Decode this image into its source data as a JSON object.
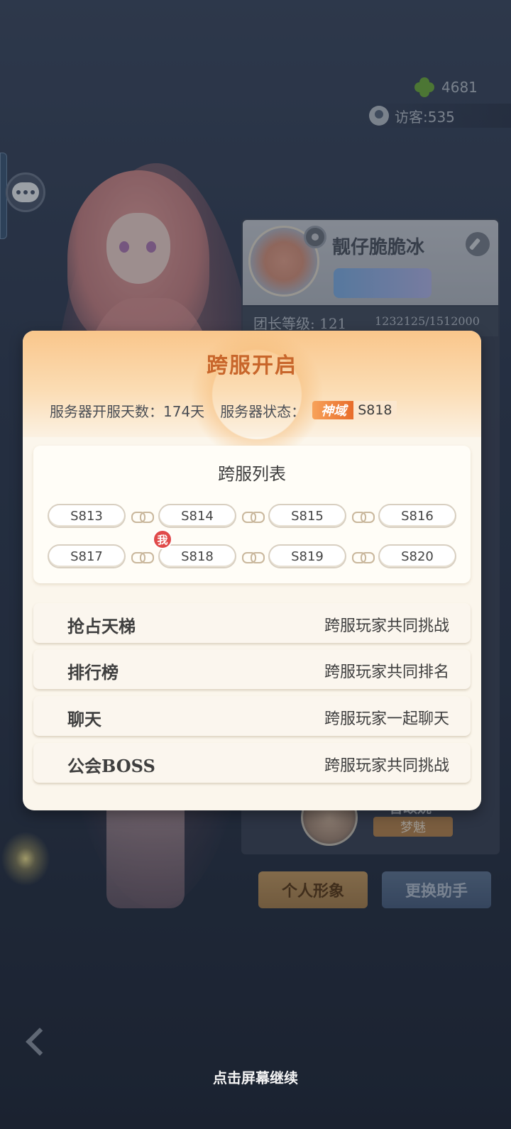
{
  "hud": {
    "clover_count": "4681",
    "visitors": "访客:535"
  },
  "profile": {
    "name": "靓仔脆脆冰",
    "level_label": "团长等级: 121",
    "exp": "1232125/1512000",
    "helper_name": "音颂婉",
    "helper_tag": "梦魅",
    "buttons": {
      "personal_image": "个人形象",
      "change_helper": "更换助手"
    }
  },
  "dialog": {
    "title": "跨服开启",
    "open_days_label": "服务器开服天数：174天",
    "status_label": "服务器状态：",
    "status_rank": "神域",
    "status_server": "S818",
    "list_title": "跨服列表",
    "me_badge": "我",
    "servers_row1": [
      "S813",
      "S814",
      "S815",
      "S816"
    ],
    "servers_row2": [
      "S817",
      "S818",
      "S819",
      "S820"
    ],
    "features": [
      {
        "name": "抢占天梯",
        "desc": "跨服玩家共同挑战"
      },
      {
        "name": "排行榜",
        "desc": "跨服玩家共同排名"
      },
      {
        "name": "聊天",
        "desc": "跨服玩家一起聊天"
      },
      {
        "name": "公会BOSS",
        "desc": "跨服玩家共同挑战"
      }
    ]
  },
  "continue_hint": "点击屏幕继续",
  "colors": {
    "title_orange": "#c8662b",
    "status_rank_bg": "#e86c2a",
    "me_badge_red": "#e04a4a",
    "dialog_bg": "#fbf6ec"
  }
}
